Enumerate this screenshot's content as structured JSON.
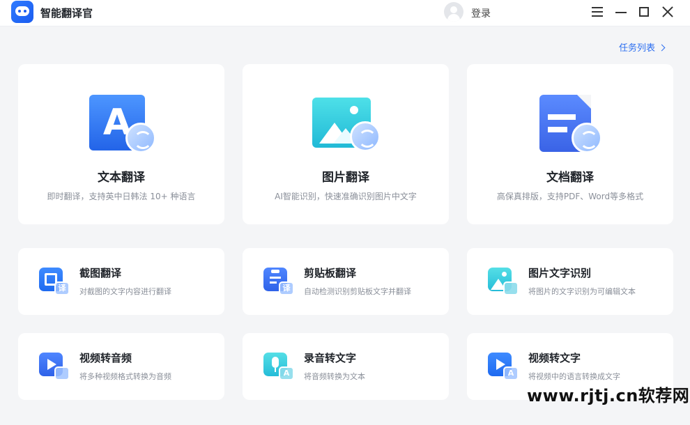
{
  "app": {
    "title": "智能翻译官",
    "login": "登录"
  },
  "task_list": "任务列表",
  "big_cards": [
    {
      "title": "文本翻译",
      "desc": "即时翻译，支持英中日韩法 10+ 种语言",
      "glyph": "A",
      "icon": "text-translate-icon"
    },
    {
      "title": "图片翻译",
      "desc": "AI智能识别，快速准确识别图片中文字",
      "icon": "image-translate-icon"
    },
    {
      "title": "文档翻译",
      "desc": "高保真排版，支持PDF、Word等多格式",
      "icon": "document-translate-icon"
    }
  ],
  "small_cards": [
    {
      "title": "截图翻译",
      "desc": "对截图的文字内容进行翻译",
      "badge": "译",
      "icon": "screenshot-translate-icon"
    },
    {
      "title": "剪贴板翻译",
      "desc": "自动检测识别剪贴板文字并翻译",
      "badge": "译",
      "icon": "clipboard-translate-icon"
    },
    {
      "title": "图片文字识别",
      "desc": "将图片的文字识别为可编辑文本",
      "icon": "image-ocr-icon"
    },
    {
      "title": "视频转音频",
      "desc": "将多种视频格式转换为音频",
      "icon": "video-to-audio-icon"
    },
    {
      "title": "录音转文字",
      "desc": "将音频转换为文本",
      "badge": "A",
      "icon": "audio-to-text-icon"
    },
    {
      "title": "视频转文字",
      "desc": "将视频中的语言转换成文字",
      "badge": "A",
      "icon": "video-to-text-icon"
    }
  ],
  "watermark": "www.rjtj.cn软荐网",
  "colors": {
    "accent": "#2d6ff0",
    "background": "#f4f5f7",
    "card": "#ffffff"
  }
}
